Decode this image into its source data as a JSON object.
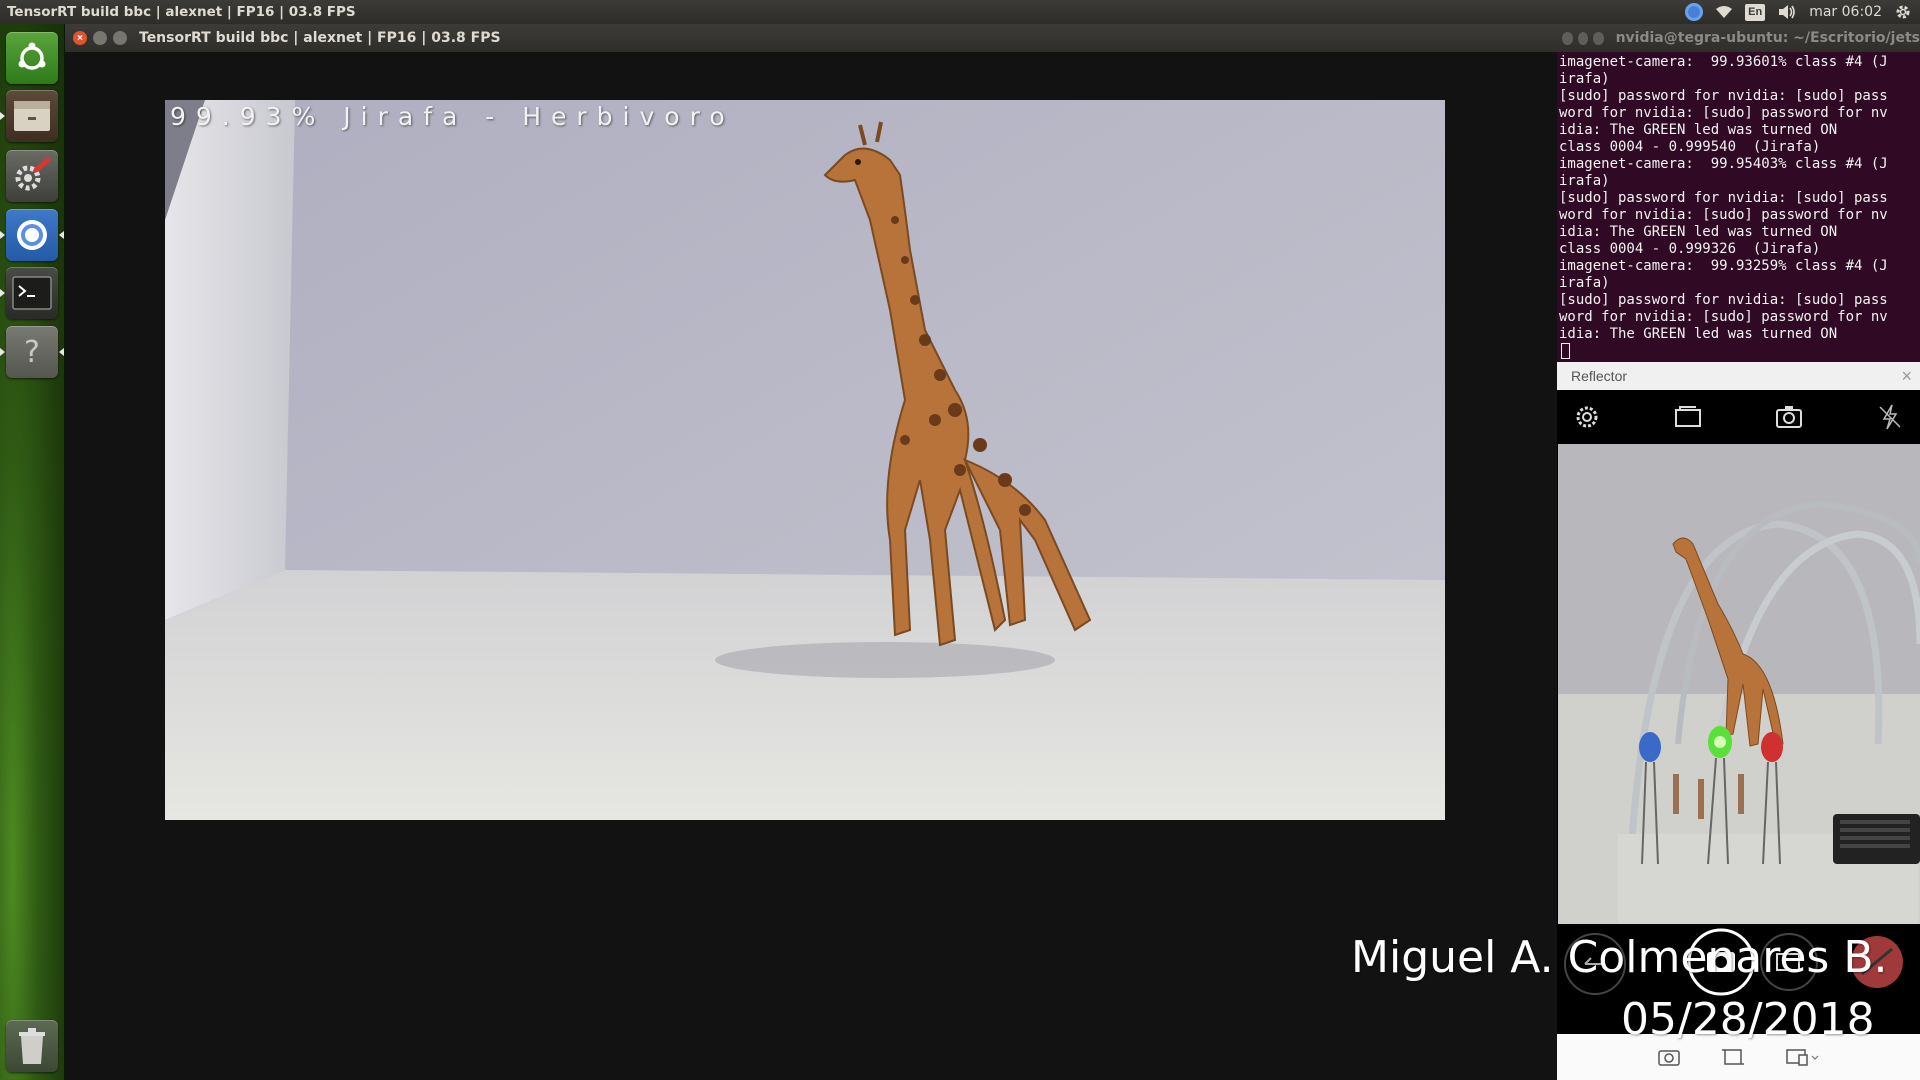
{
  "top_panel": {
    "title": "TensorRT build bbc | alexnet | FP16 | 03.8 FPS",
    "keyboard_layout": "En",
    "clock": "mar 06:02"
  },
  "launcher": {
    "items": [
      "dash",
      "files",
      "system-settings",
      "chromium",
      "terminal",
      "help",
      "trash"
    ]
  },
  "camera_window": {
    "title": "TensorRT build bbc | alexnet | FP16 | 03.8 FPS",
    "overlay_text": "99.93% Jirafa - Herbivoro"
  },
  "terminal": {
    "title": "nvidia@tegra-ubuntu: ~/Escritorio/jets",
    "lines": [
      "imagenet-camera:  99.93601% class #4 (J",
      "irafa)",
      "[sudo] password for nvidia: [sudo] pass",
      "word for nvidia: [sudo] password for nv",
      "idia: The GREEN led was turned ON",
      "class 0004 - 0.999540  (Jirafa)",
      "imagenet-camera:  99.95403% class #4 (J",
      "irafa)",
      "[sudo] password for nvidia: [sudo] pass",
      "word for nvidia: [sudo] password for nv",
      "idia: The GREEN led was turned ON",
      "class 0004 - 0.999326  (Jirafa)",
      "imagenet-camera:  99.93259% class #4 (J",
      "irafa)",
      "[sudo] password for nvidia: [sudo] pass",
      "word for nvidia: [sudo] password for nv",
      "idia: The GREEN led was turned ON"
    ]
  },
  "reflector": {
    "title": "Reflector",
    "toolbar_icons": [
      "settings-icon",
      "gallery-icon",
      "switch-camera-icon",
      "flash-off-icon"
    ],
    "controls_icons": [
      "back-icon",
      "shutter-icon",
      "video-icon",
      "thumbnail"
    ],
    "bottom_icons": [
      "camera-mode-icon",
      "crop-icon",
      "device-icon"
    ]
  },
  "watermark": {
    "name": "Miguel A. Colmenares B.",
    "date": "05/28/2018"
  },
  "colors": {
    "panel": "#3c3b37",
    "terminal_bg": "#300a24",
    "close_button": "#e0562c",
    "launcher_green": "#2f5a14"
  }
}
